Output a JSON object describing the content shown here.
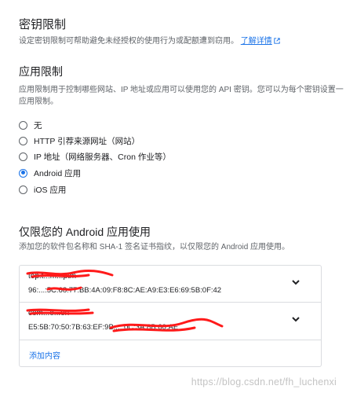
{
  "key_restrictions": {
    "title": "密钥限制",
    "description": "设定密钥限制可帮助避免未经授权的使用行为或配额遭到窃用。",
    "learn_more": "了解详情"
  },
  "app_restrictions": {
    "title": "应用限制",
    "description_line1": "应用限制用于控制哪些网站、IP 地址或应用可以使用您的 API 密钥。您可以为每个密钥设置一",
    "description_line2": "应用限制。",
    "options": [
      {
        "label": "无",
        "selected": false
      },
      {
        "label": "HTTP 引荐来源网址（网站）",
        "selected": false
      },
      {
        "label": "IP 地址（网络服务器、Cron 作业等）",
        "selected": false
      },
      {
        "label": "Android 应用",
        "selected": true
      },
      {
        "label": "iOS 应用",
        "selected": false
      }
    ]
  },
  "android_restrict": {
    "title": "仅限您的 Android 应用使用",
    "description": "添加您的软件包名称和 SHA-1 签名证书指纹，以仅限您的 Android 应用使用。",
    "apps": [
      {
        "package": "top.t...m...ptm",
        "sha1": "96:...:5C:68:77:BB:4A:09:F8:8C:AE:A9:E3:E6:69:5B:0F:42"
      },
      {
        "package": "com...e...on",
        "sha1": "E5:5B:70:50:7B:63:EF:9B:...:0C:3A:8B:60:AE"
      }
    ],
    "add_label": "添加内容"
  },
  "watermark": "https://blog.csdn.net/fh_luchenxi",
  "colors": {
    "accent": "#1a73e8",
    "text": "#202124",
    "muted": "#5f6368",
    "border": "#dadce0",
    "redaction": "#ff1a1a"
  },
  "icons": {
    "external_link": "external-link-icon",
    "expand": "chevron-down-icon"
  }
}
